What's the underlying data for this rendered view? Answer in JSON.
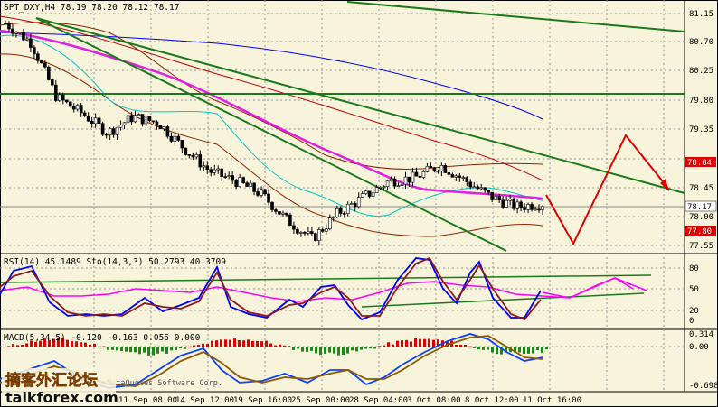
{
  "main": {
    "title": "SPT_DXY,H4  78.19 78.20 78.12 78.17",
    "price_labels": [
      "81.15",
      "80.70",
      "80.25",
      "79.80",
      "79.35",
      "78.84",
      "78.45",
      "78.17",
      "78.00",
      "77.80",
      "77.55"
    ],
    "current_price": "78.17",
    "tag_8884": "78.84",
    "tag_7780": "77.80",
    "watermark_faint": "MetaQuotes Software Corp."
  },
  "rsi": {
    "title": "RSI(14) 45.1489  Sto(14,3,3) 50.2793 40.3709",
    "levels": [
      "80",
      "50",
      "20",
      "0"
    ]
  },
  "macd": {
    "title": "MACD(5,34,5) -0.120 -0.163 0.056 0.000",
    "levels": [
      "0.314",
      "0.00",
      "-0.698"
    ]
  },
  "time_axis": {
    "labels": [
      "11 Sep 08:00",
      "14 Sep 12:00",
      "19 Sep 16:00",
      "25 Sep 00:00",
      "28 Sep 04:00",
      "3 Oct 08:00",
      "8 Oct 12:00",
      "11 Oct 16:00"
    ]
  },
  "watermark": {
    "cn": "摘客外汇论坛",
    "site": "talkforex.com"
  },
  "chart_data": {
    "type": "line",
    "title": "SPT_DXY,H4",
    "ylim": [
      77.4,
      81.3
    ],
    "categories": [
      "11 Sep 08:00",
      "14 Sep 12:00",
      "19 Sep 16:00",
      "25 Sep 00:00",
      "28 Sep 04:00",
      "3 Oct 08:00",
      "8 Oct 12:00",
      "11 Oct 16:00"
    ],
    "series": [
      {
        "values": [
          81.0,
          80.7,
          79.85,
          79.6,
          79.3,
          79.55,
          79.45,
          79.05,
          78.7,
          78.55,
          78.35,
          77.95,
          77.65,
          78.05,
          78.3,
          78.55,
          78.6,
          78.8,
          78.55,
          78.3,
          78.15,
          78.2
        ]
      }
    ],
    "ohlc_last": {
      "open": 78.19,
      "high": 78.2,
      "low": 78.12,
      "close": 78.17
    }
  }
}
